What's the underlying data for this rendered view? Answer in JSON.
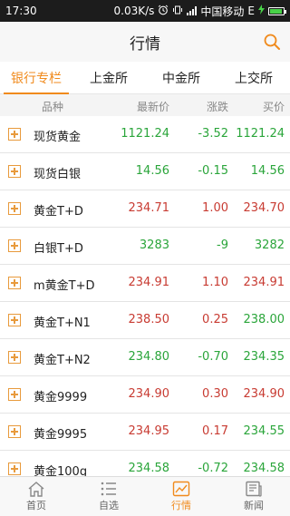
{
  "status_bar": {
    "time": "17:30",
    "speed": "0.03K/s",
    "carrier": "中国移动",
    "network": "E",
    "battery_level": 0.9,
    "icons": [
      "alarm-icon",
      "vibrate-icon",
      "signal-icon",
      "battery-icon"
    ]
  },
  "header": {
    "title": "行情",
    "search_icon": "search-icon"
  },
  "tabs": [
    {
      "label": "银行专栏",
      "active": true
    },
    {
      "label": "上金所",
      "active": false
    },
    {
      "label": "中金所",
      "active": false
    },
    {
      "label": "上交所",
      "active": false
    }
  ],
  "columns": {
    "name": "品种",
    "price": "最新价",
    "change": "涨跌",
    "bid": "买价"
  },
  "rows": [
    {
      "name": "现货黄金",
      "price": "1121.24",
      "change": "-3.52",
      "bid": "1121.24",
      "trend": "down"
    },
    {
      "name": "现货白银",
      "price": "14.56",
      "change": "-0.15",
      "bid": "14.56",
      "trend": "down"
    },
    {
      "name": "黄金T+D",
      "price": "234.71",
      "change": "1.00",
      "bid": "234.70",
      "trend": "up"
    },
    {
      "name": "白银T+D",
      "price": "3283",
      "change": "-9",
      "bid": "3282",
      "trend": "down"
    },
    {
      "name": "m黄金T+D",
      "price": "234.91",
      "change": "1.10",
      "bid": "234.91",
      "trend": "up"
    },
    {
      "name": "黄金T+N1",
      "price": "238.50",
      "change": "0.25",
      "bid": "238.00",
      "trend": "mixed"
    },
    {
      "name": "黄金T+N2",
      "price": "234.80",
      "change": "-0.70",
      "bid": "234.35",
      "trend": "down"
    },
    {
      "name": "黄金9999",
      "price": "234.90",
      "change": "0.30",
      "bid": "234.90",
      "trend": "up"
    },
    {
      "name": "黄金9995",
      "price": "234.95",
      "change": "0.17",
      "bid": "234.55",
      "trend": "mixed"
    },
    {
      "name": "黄金100g",
      "price": "234.58",
      "change": "-0.72",
      "bid": "234.58",
      "trend": "down"
    }
  ],
  "colors": {
    "accent": "#f08a1c",
    "up": "#c83b32",
    "down": "#2aa53a"
  },
  "nav": [
    {
      "label": "首页",
      "icon": "home-icon",
      "active": false
    },
    {
      "label": "自选",
      "icon": "list-icon",
      "active": false
    },
    {
      "label": "行情",
      "icon": "chart-icon",
      "active": true
    },
    {
      "label": "新闻",
      "icon": "news-icon",
      "active": false
    }
  ]
}
